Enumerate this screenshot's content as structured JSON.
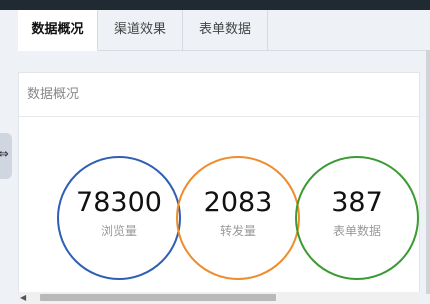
{
  "tabs": [
    {
      "label": "数据概况",
      "active": true
    },
    {
      "label": "渠道效果",
      "active": false
    },
    {
      "label": "表单数据",
      "active": false
    }
  ],
  "card": {
    "title": "数据概况"
  },
  "stats": [
    {
      "value": "78300",
      "label": "浏览量",
      "color": "#2f5fb3"
    },
    {
      "value": "2083",
      "label": "转发量",
      "color": "#ef8c2c"
    },
    {
      "value": "387",
      "label": "表单数据",
      "color": "#3b9b33"
    }
  ],
  "icons": {
    "left_handle": "collapse-arrows-icon",
    "scroll_left": "scroll-left-arrow-icon"
  }
}
